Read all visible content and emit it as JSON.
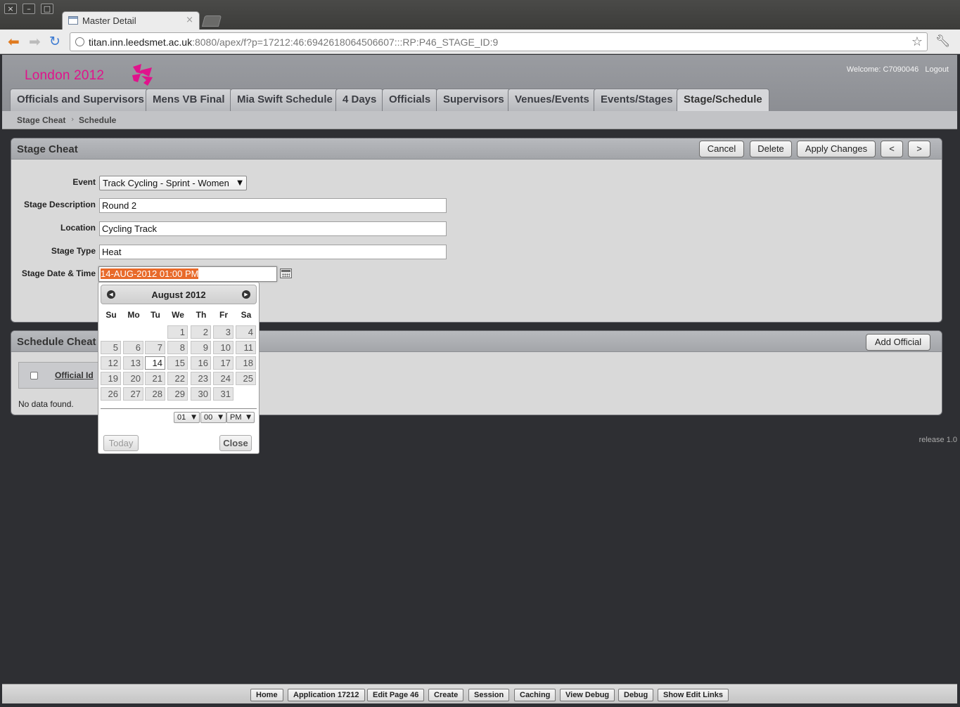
{
  "browser": {
    "tab_title": "Master Detail",
    "tab_close": "×",
    "url_host": "titan.inn.leedsmet.ac.uk",
    "url_rest": ":8080/apex/f?p=17212:46:6942618064506607:::RP:P46_STAGE_ID:9",
    "window_buttons": [
      "×",
      "–",
      "□"
    ]
  },
  "header": {
    "logo_text": "London 2012",
    "welcome": "Welcome: C7090046",
    "logout": "Logout"
  },
  "tabs": [
    "Officials and Supervisors",
    "Mens VB Final",
    "Mia Swift Schedule",
    "4 Days",
    "Officials",
    "Supervisors",
    "Venues/Events",
    "Events/Stages",
    "Stage/Schedule"
  ],
  "active_tab": "Stage/Schedule",
  "breadcrumb": [
    "Stage Cheat",
    "Schedule"
  ],
  "stage_region": {
    "title": "Stage Cheat",
    "buttons": {
      "cancel": "Cancel",
      "delete": "Delete",
      "apply": "Apply Changes",
      "prev": "<",
      "next": ">"
    },
    "fields": {
      "event_label": "Event",
      "event_value": "Track Cycling - Sprint - Women",
      "desc_label": "Stage Description",
      "desc_value": "Round 2",
      "location_label": "Location",
      "location_value": "Cycling Track",
      "type_label": "Stage Type",
      "type_value": "Heat",
      "datetime_label": "Stage Date & Time",
      "datetime_value": "14-AUG-2012 01:00 PM"
    }
  },
  "schedule_region": {
    "title": "Schedule Cheat",
    "add_button": "Add Official",
    "col_official_id": "Official Id",
    "no_data": "No data found."
  },
  "datepicker": {
    "month_title": "August 2012",
    "weekdays": [
      "Su",
      "Mo",
      "Tu",
      "We",
      "Th",
      "Fr",
      "Sa"
    ],
    "days": [
      "1",
      "2",
      "3",
      "4",
      "5",
      "6",
      "7",
      "8",
      "9",
      "10",
      "11",
      "12",
      "13",
      "14",
      "15",
      "16",
      "17",
      "18",
      "19",
      "20",
      "21",
      "22",
      "23",
      "24",
      "25",
      "26",
      "27",
      "28",
      "29",
      "30",
      "31"
    ],
    "selected_day": "14",
    "hour": "01",
    "minute": "00",
    "ampm": "PM",
    "today_button": "Today",
    "close_button": "Close"
  },
  "release": "release 1.0",
  "dev_toolbar": [
    "Home",
    "Application 17212",
    "Edit Page 46",
    "Create",
    "Session",
    "Caching",
    "View Debug",
    "Debug",
    "Show Edit Links"
  ],
  "colors": {
    "brand_magenta": "#e0138c",
    "selection_orange": "#e86a2a",
    "page_bg": "#2e2f33"
  }
}
